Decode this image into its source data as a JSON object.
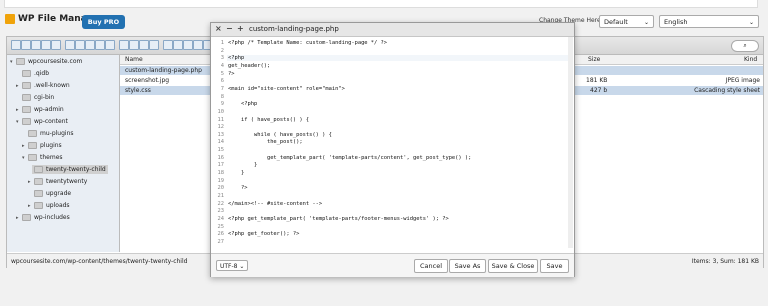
{
  "app": {
    "title": "WP File Manager",
    "buy_pro": "Buy PRO"
  },
  "header": {
    "theme_label": "Change Theme Here:",
    "theme_value": "Default",
    "language_value": "English"
  },
  "search": {
    "icon_text": "⌕"
  },
  "tree": {
    "root": "wpcoursesite.com",
    "items": [
      ".qidb",
      ".well-known",
      "cgi-bin",
      "wp-admin",
      "wp-content",
      "mu-plugins",
      "plugins",
      "themes",
      "twenty-twenty-child",
      "twentytwenty",
      "upgrade",
      "uploads",
      "wp-includes"
    ]
  },
  "files": {
    "headers": {
      "name": "Name",
      "size": "Size",
      "kind": "Kind"
    },
    "rows": [
      {
        "name": "custom-landing-page.php",
        "size": "",
        "kind": ""
      },
      {
        "name": "screenshot.jpg",
        "size": "181 KB",
        "kind": "JPEG image"
      },
      {
        "name": "style.css",
        "size": "427 b",
        "kind": "Cascading style sheet"
      }
    ]
  },
  "status": {
    "path": "wpcoursesite.com/wp-content/themes/twenty-twenty-child",
    "summary": "Items: 3, Sum: 181 KB"
  },
  "editor": {
    "title": "custom-landing-page.php",
    "controls": {
      "close": "×",
      "minimize": "−",
      "maximize": "+"
    },
    "lines": [
      "<?php /* Template Name: custom-landing-page */ ?>",
      "",
      "<?php",
      "get_header();",
      "?>",
      "",
      "<main id=\"site-content\" role=\"main\">",
      "",
      "    <?php",
      "",
      "    if ( have_posts() ) {",
      "",
      "        while ( have_posts() ) {",
      "            the_post();",
      "",
      "            get_template_part( 'template-parts/content', get_post_type() );",
      "        }",
      "    }",
      "",
      "    ?>",
      "",
      "</main><!-- #site-content -->",
      "",
      "<?php get_template_part( 'template-parts/footer-menus-widgets' ); ?>",
      "",
      "<?php get_footer(); ?>",
      ""
    ],
    "encoding": "UTF-8",
    "buttons": {
      "cancel": "Cancel",
      "save_as": "Save As",
      "save_close": "Save & Close",
      "save": "Save"
    }
  }
}
